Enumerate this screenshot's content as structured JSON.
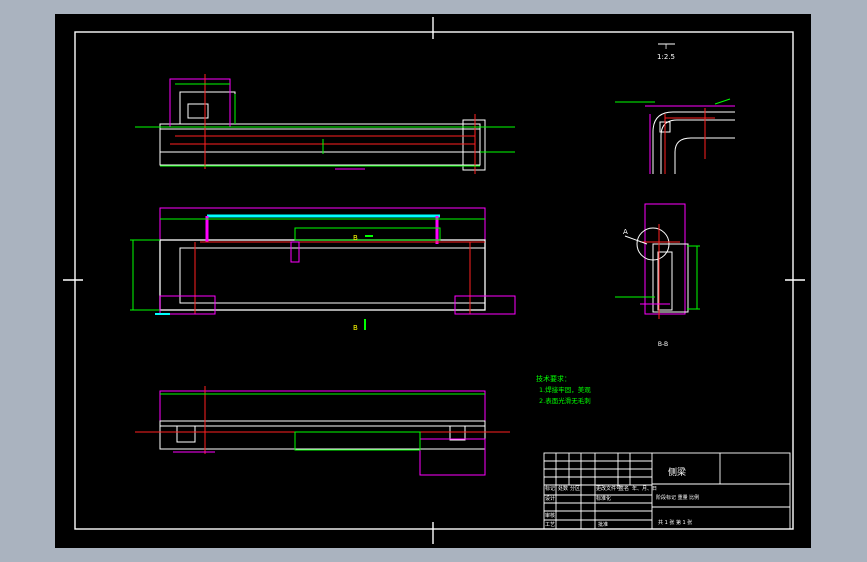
{
  "drawing": {
    "scale_label": "I",
    "scale_value": "1:2.5",
    "section_label": "B-B",
    "view_marker_a": "A",
    "view_marker_b": "B",
    "tech_requirements_title": "技术要求：",
    "tech_requirements": [
      "1.焊接牢固，美观",
      "2.表面光滑无毛刺"
    ]
  },
  "title_block": {
    "part_name": "侧梁",
    "row_headers": [
      "标记",
      "处数",
      "分区",
      "更改文件号",
      "签名",
      "年、月、日"
    ],
    "design": "设计",
    "standardization": "标准化",
    "review": "审核",
    "process": "工艺",
    "approve": "批准",
    "stage_mark_labels": "阶段标记  重量  比例",
    "sheets": "共 1 张   第 1 张"
  },
  "colors": {
    "sheet": "#000000",
    "frame": "#ffffff",
    "dimension": "#00ff00",
    "extension": "#ff00ff",
    "centerline": "#ff2020",
    "highlight": "#00ffff",
    "label": "#ffff00"
  }
}
